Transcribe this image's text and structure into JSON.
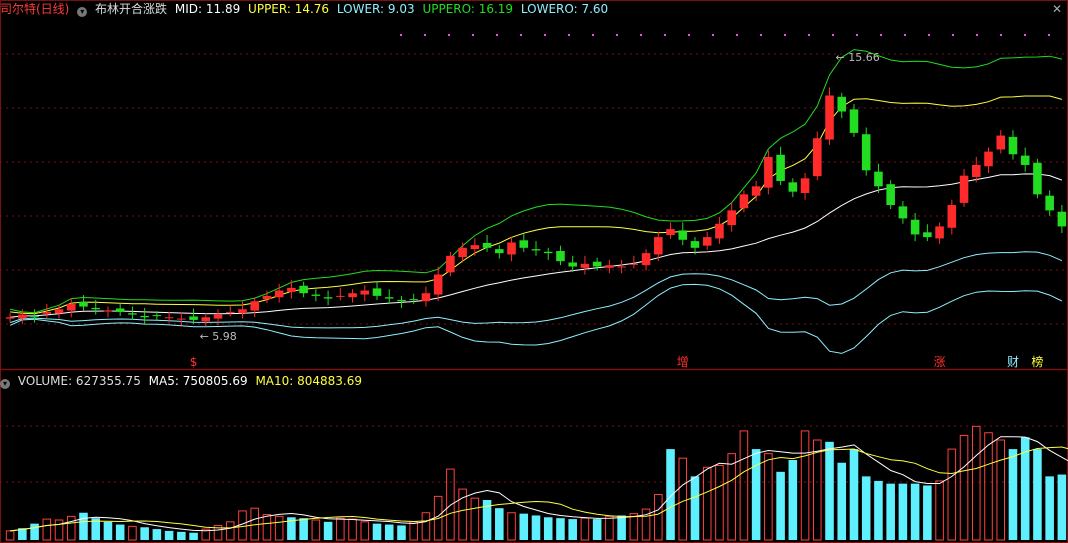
{
  "header": {
    "title": "司尔特(日线)",
    "indicator": "布林开合涨跌",
    "mid": "MID: 11.89",
    "upper": "UPPER: 14.76",
    "lower": "LOWER: 9.03",
    "uppero": "UPPERO: 16.19",
    "lowero": "LOWERO: 7.60",
    "close_icon": "close-icon"
  },
  "volume_header": {
    "volume": "VOLUME: 627355.75",
    "ma5": "MA5: 750805.69",
    "ma10": "MA10: 804883.69"
  },
  "colors": {
    "up": "#ff2b2b",
    "down": "#22dd22",
    "vol_up": "#ff4040",
    "vol_down": "#5ff0ff",
    "mid": "#ffffff",
    "upper": "#ffff40",
    "lower": "#8ef0ff",
    "uppero": "#22dd22",
    "lowero": "#8ef0ff",
    "ma5": "#ffffff",
    "ma10": "#ffff40",
    "grid": "#7a1010"
  },
  "chart_data": {
    "type": "candlestick",
    "price_range": [
      5.0,
      17.5
    ],
    "volume_range": [
      0,
      1650000
    ],
    "annotations": [
      {
        "text": "15.66",
        "index": 67,
        "value": 15.66,
        "kind": "high"
      },
      {
        "text": "5.98",
        "index": 15,
        "value": 5.98,
        "kind": "low"
      }
    ],
    "markers": [
      {
        "text": "$",
        "index": 15,
        "color": "#ff3030"
      },
      {
        "text": "增",
        "index": 55,
        "color": "#ff3030"
      },
      {
        "text": "涨",
        "index": 76,
        "color": "#ff3030"
      },
      {
        "text": "财",
        "index": 82,
        "color": "#8ef0ff"
      },
      {
        "text": "榜",
        "index": 84,
        "color": "#ffff40"
      }
    ],
    "close": [
      6.3,
      6.4,
      6.35,
      6.5,
      6.6,
      6.8,
      6.7,
      6.6,
      6.55,
      6.5,
      6.4,
      6.3,
      6.35,
      6.3,
      6.25,
      6.2,
      6.3,
      6.4,
      6.5,
      6.6,
      6.9,
      7.1,
      7.3,
      7.4,
      7.2,
      7.1,
      7.0,
      7.1,
      7.2,
      7.3,
      7.1,
      7.0,
      6.9,
      6.95,
      7.2,
      7.9,
      8.6,
      8.9,
      9.0,
      8.9,
      8.7,
      9.1,
      8.9,
      8.8,
      8.7,
      8.4,
      8.2,
      8.3,
      8.2,
      8.25,
      8.2,
      8.3,
      8.7,
      9.3,
      9.6,
      9.2,
      8.9,
      9.3,
      9.8,
      10.3,
      10.9,
      11.2,
      12.3,
      11.4,
      11.0,
      11.5,
      13.0,
      14.6,
      14.0,
      13.2,
      11.8,
      11.2,
      10.5,
      10.0,
      9.4,
      9.3,
      9.7,
      10.5,
      11.6,
      12.0,
      12.5,
      13.1,
      12.4,
      12.0,
      10.9,
      10.3,
      9.7
    ],
    "volume": [
      100000,
      130000,
      180000,
      230000,
      220000,
      260000,
      300000,
      240000,
      200000,
      170000,
      150000,
      140000,
      120000,
      100000,
      90000,
      80000,
      120000,
      160000,
      200000,
      320000,
      350000,
      280000,
      260000,
      250000,
      240000,
      220000,
      200000,
      240000,
      230000,
      200000,
      180000,
      170000,
      160000,
      200000,
      300000,
      480000,
      780000,
      560000,
      460000,
      440000,
      350000,
      300000,
      290000,
      270000,
      250000,
      240000,
      230000,
      240000,
      230000,
      260000,
      270000,
      290000,
      340000,
      500000,
      1000000,
      900000,
      700000,
      800000,
      820000,
      950000,
      1200000,
      1000000,
      950000,
      750000,
      880000,
      1200000,
      1100000,
      1080000,
      850000,
      1000000,
      700000,
      650000,
      620000,
      620000,
      620000,
      600000,
      650000,
      1000000,
      1150000,
      1250000,
      1180000,
      1100000,
      1000000,
      1130000,
      1000000,
      700000,
      720000,
      630000
    ],
    "vol_up_flags": [
      1,
      0,
      0,
      1,
      1,
      1,
      0,
      0,
      0,
      0,
      1,
      0,
      0,
      0,
      0,
      0,
      1,
      1,
      1,
      1,
      1,
      1,
      1,
      0,
      0,
      1,
      0,
      1,
      1,
      1,
      0,
      0,
      0,
      1,
      1,
      1,
      1,
      1,
      1,
      0,
      0,
      1,
      0,
      0,
      0,
      0,
      0,
      1,
      0,
      1,
      0,
      1,
      1,
      1,
      0,
      1,
      0,
      1,
      1,
      1,
      1,
      0,
      1,
      0,
      0,
      1,
      1,
      0,
      0,
      0,
      0,
      0,
      0,
      0,
      0,
      0,
      1,
      1,
      1,
      1,
      1,
      1,
      0,
      0,
      0,
      0,
      0
    ],
    "series": [
      {
        "name": "MID",
        "last": 11.89
      },
      {
        "name": "UPPER",
        "last": 14.76
      },
      {
        "name": "LOWER",
        "last": 9.03
      },
      {
        "name": "UPPERO",
        "last": 16.19
      },
      {
        "name": "LOWERO",
        "last": 7.6
      }
    ]
  }
}
